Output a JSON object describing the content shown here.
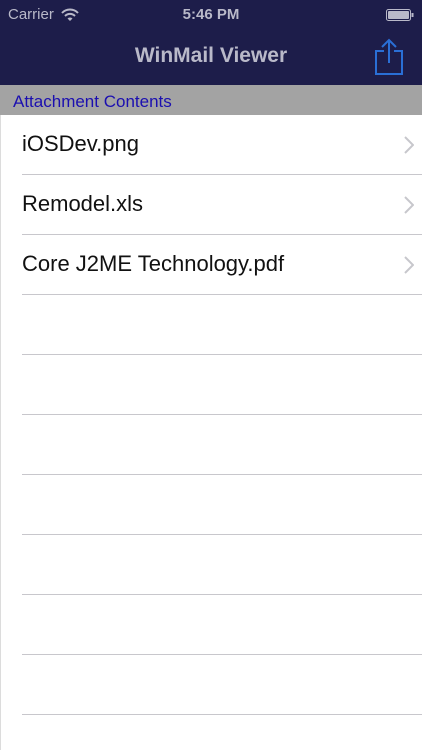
{
  "status_bar": {
    "carrier": "Carrier",
    "time": "5:46 PM",
    "wifi_icon": "wifi-icon",
    "battery_icon": "battery-icon"
  },
  "nav_bar": {
    "title": "WinMail Viewer",
    "share_icon": "share-icon"
  },
  "section": {
    "header": "Attachment Contents"
  },
  "attachments": [
    {
      "name": "iOSDev.png"
    },
    {
      "name": "Remodel.xls"
    },
    {
      "name": "Core J2ME Technology.pdf"
    }
  ],
  "colors": {
    "nav_background": "#1d1d4a",
    "nav_text": "#b9b9c9",
    "section_background": "#a3a3a3",
    "section_text": "#1b0fb0",
    "share_icon": "#2a6fd6"
  }
}
